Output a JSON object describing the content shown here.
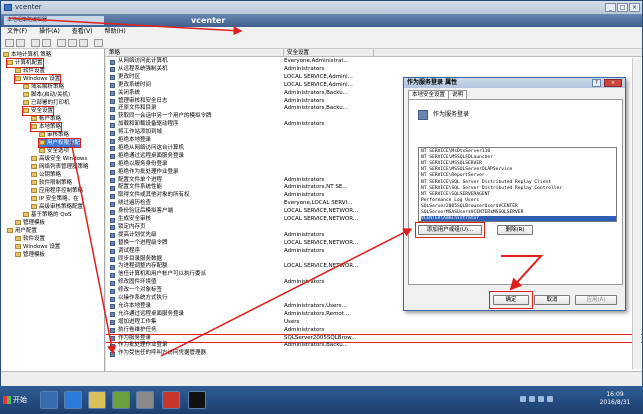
{
  "window": {
    "title": "vcenter",
    "banner_title": "vcenter",
    "mini_title": "本地组策略编辑器",
    "controls": [
      "_",
      "□",
      "×"
    ]
  },
  "menu": [
    "文件(F)",
    "操作(A)",
    "查看(V)",
    "帮助(H)"
  ],
  "tree": [
    {
      "label": "本地计算机 策略",
      "hl": false
    },
    {
      "label": "计算机配置",
      "hl": true
    },
    {
      "label": "软件设置",
      "hl": false
    },
    {
      "label": "Windows 设置",
      "hl": true
    },
    {
      "label": "域名解析策略",
      "hl": false
    },
    {
      "label": "脚本(启动/关机)",
      "hl": false
    },
    {
      "label": "已部署的打印机",
      "hl": false
    },
    {
      "label": "安全设置",
      "hl": true
    },
    {
      "label": "帐户策略",
      "hl": false
    },
    {
      "label": "本地策略",
      "hl": true
    },
    {
      "label": "审核策略",
      "hl": false
    },
    {
      "label": "用户权限分配",
      "hl": true,
      "sel": true
    },
    {
      "label": "安全选项",
      "hl": false
    },
    {
      "label": "高级安全 Windows",
      "hl": false
    },
    {
      "label": "网络列表管理器策略",
      "hl": false
    },
    {
      "label": "公钥策略",
      "hl": false
    },
    {
      "label": "软件限制策略",
      "hl": false
    },
    {
      "label": "应用程序控制策略",
      "hl": false
    },
    {
      "label": "IP 安全策略，在",
      "hl": false
    },
    {
      "label": "高级审核策略配置",
      "hl": false
    },
    {
      "label": "基于策略的 QoS",
      "hl": false
    },
    {
      "label": "管理模板",
      "hl": false
    },
    {
      "label": "用户配置",
      "hl": false
    },
    {
      "label": "软件设置",
      "hl": false
    },
    {
      "label": "Windows 设置",
      "hl": false
    },
    {
      "label": "管理模板",
      "hl": false
    }
  ],
  "list": {
    "col_policy": "策略",
    "col_setting": "安全设置",
    "rows": [
      {
        "policy": "从网络访问此计算机",
        "setting": "Everyone,Administrat..."
      },
      {
        "policy": "从远程系统强制关机",
        "setting": "Administrators"
      },
      {
        "policy": "更改时区",
        "setting": "LOCAL SERVICE,Admini..."
      },
      {
        "policy": "更改系统时间",
        "setting": "LOCAL SERVICE,Admini..."
      },
      {
        "policy": "关闭系统",
        "setting": "Administrators,Backu..."
      },
      {
        "policy": "管理审核和安全日志",
        "setting": "Administrators"
      },
      {
        "policy": "还原文件和目录",
        "setting": "Administrators,Backu..."
      },
      {
        "policy": "获取同一会话中另一个用户的模拟令牌",
        "setting": ""
      },
      {
        "policy": "加载和卸载设备驱动程序",
        "setting": "Administrators"
      },
      {
        "policy": "将工作站添加到域",
        "setting": ""
      },
      {
        "policy": "拒绝本地登录",
        "setting": ""
      },
      {
        "policy": "拒绝从网络访问这台计算机",
        "setting": ""
      },
      {
        "policy": "拒绝通过远程桌面服务登录",
        "setting": ""
      },
      {
        "policy": "拒绝以服务身份登录",
        "setting": ""
      },
      {
        "policy": "拒绝作为批处理作业登录",
        "setting": ""
      },
      {
        "policy": "配置文件单个进程",
        "setting": "Administrators"
      },
      {
        "policy": "配置文件系统性能",
        "setting": "Administrators,NT SE..."
      },
      {
        "policy": "取得文件或其他对象的所有权",
        "setting": "Administrators"
      },
      {
        "policy": "绕过遍历检查",
        "setting": "Everyone,LOCAL SERVI..."
      },
      {
        "policy": "身份验证后模拟客户端",
        "setting": "LOCAL SERVICE,NETWOR..."
      },
      {
        "policy": "生成安全审核",
        "setting": "LOCAL SERVICE,NETWOR..."
      },
      {
        "policy": "锁定内存页",
        "setting": ""
      },
      {
        "policy": "提高计划优先级",
        "setting": "Administrators"
      },
      {
        "policy": "替换一个进程级令牌",
        "setting": "LOCAL SERVICE,NETWOR..."
      },
      {
        "policy": "调试程序",
        "setting": "Administrators"
      },
      {
        "policy": "同步目录服务数据",
        "setting": ""
      },
      {
        "policy": "为进程调整内存配额",
        "setting": "LOCAL SERVICE,NETWOR..."
      },
      {
        "policy": "信任计算机和用户帐户可以执行委派",
        "setting": ""
      },
      {
        "policy": "修改固件环境值",
        "setting": "Administrators"
      },
      {
        "policy": "修改一个对象标签",
        "setting": ""
      },
      {
        "policy": "以操作系统方式执行",
        "setting": ""
      },
      {
        "policy": "允许本地登录",
        "setting": "Administrators,Users..."
      },
      {
        "policy": "允许通过远程桌面服务登录",
        "setting": "Administrators,Remot..."
      },
      {
        "policy": "增加进程工作集",
        "setting": "Users"
      },
      {
        "policy": "执行卷维护任务",
        "setting": "Administrators"
      },
      {
        "policy": "作为服务登录",
        "setting": "SQLServer2005SQLBrow...",
        "hi": true
      },
      {
        "policy": "作为批处理作业登录",
        "setting": "Administrators,Backu..."
      },
      {
        "policy": "作为受信任的呼叫方访问凭据管理器",
        "setting": ""
      }
    ]
  },
  "dialog": {
    "title": "作为服务登录 属性",
    "help_glyph": "?",
    "close_glyph": "×",
    "tab_local": "本地安全设置",
    "tab_explain": "说明",
    "policy_name": "作为服务登录",
    "accounts": [
      "NT SERVICE\\MsDtsServer110",
      "NT SERVICE\\MSSQLFDLauncher",
      "NT SERVICE\\MSSQLSERVER",
      "NT SERVICE\\MSSQLServerOLAPService",
      "NT SERVICE\\ReportServer",
      "NT SERVICE\\SQL Server Distributed Replay Client",
      "NT SERVICE\\SQL Server Distributed Replay Controller",
      "NT SERVICE\\SQLSERVERAGENT",
      "Performance Log Users",
      "SQLServer2005SQLBrowserUser$VCENTER",
      "SQLServerMSASUser$VCENTER$MSSQLSERVER",
      "VCENTER\\Administrator"
    ],
    "selected_account_index": 11,
    "add_button": "添加用户或组(U)...",
    "remove_button": "删除(R)",
    "ok_button": "确定",
    "cancel_button": "取消",
    "apply_button": "应用(A)"
  },
  "taskbar": {
    "start": "开始",
    "time": "16:09",
    "date": "2016/8/31"
  },
  "colors": {
    "highlight": "#e0201a",
    "selection": "#3b78d8",
    "titlebar": "#b9c8da"
  }
}
